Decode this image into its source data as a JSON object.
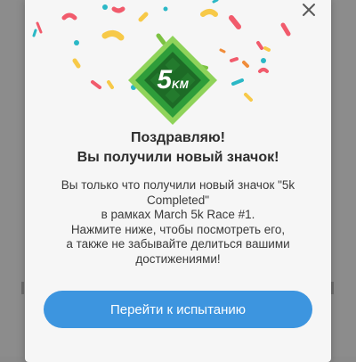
{
  "dialog": {
    "badge": {
      "number": "5",
      "unit": "KM"
    },
    "title_line1": "Поздравляю!",
    "title_line2": "Вы получили новый значок!",
    "message_lines": [
      "Вы только что получили новый значок \"5k",
      "Completed\"",
      "в рамках March 5k Race #1.",
      "Нажмите ниже, чтобы посмотреть его,",
      "а также не забывайте делиться вашими",
      "достижениями!"
    ],
    "cta_label": "Перейти к испытанию",
    "close_icon": "close-icon"
  },
  "colors": {
    "accent": "#3d95df",
    "badge_green": "#2e9d3a",
    "badge_light": "#8fd35a",
    "confetti": [
      "#f15b6c",
      "#f7c948",
      "#2bb8c6",
      "#7cc242",
      "#f08c3a"
    ]
  }
}
